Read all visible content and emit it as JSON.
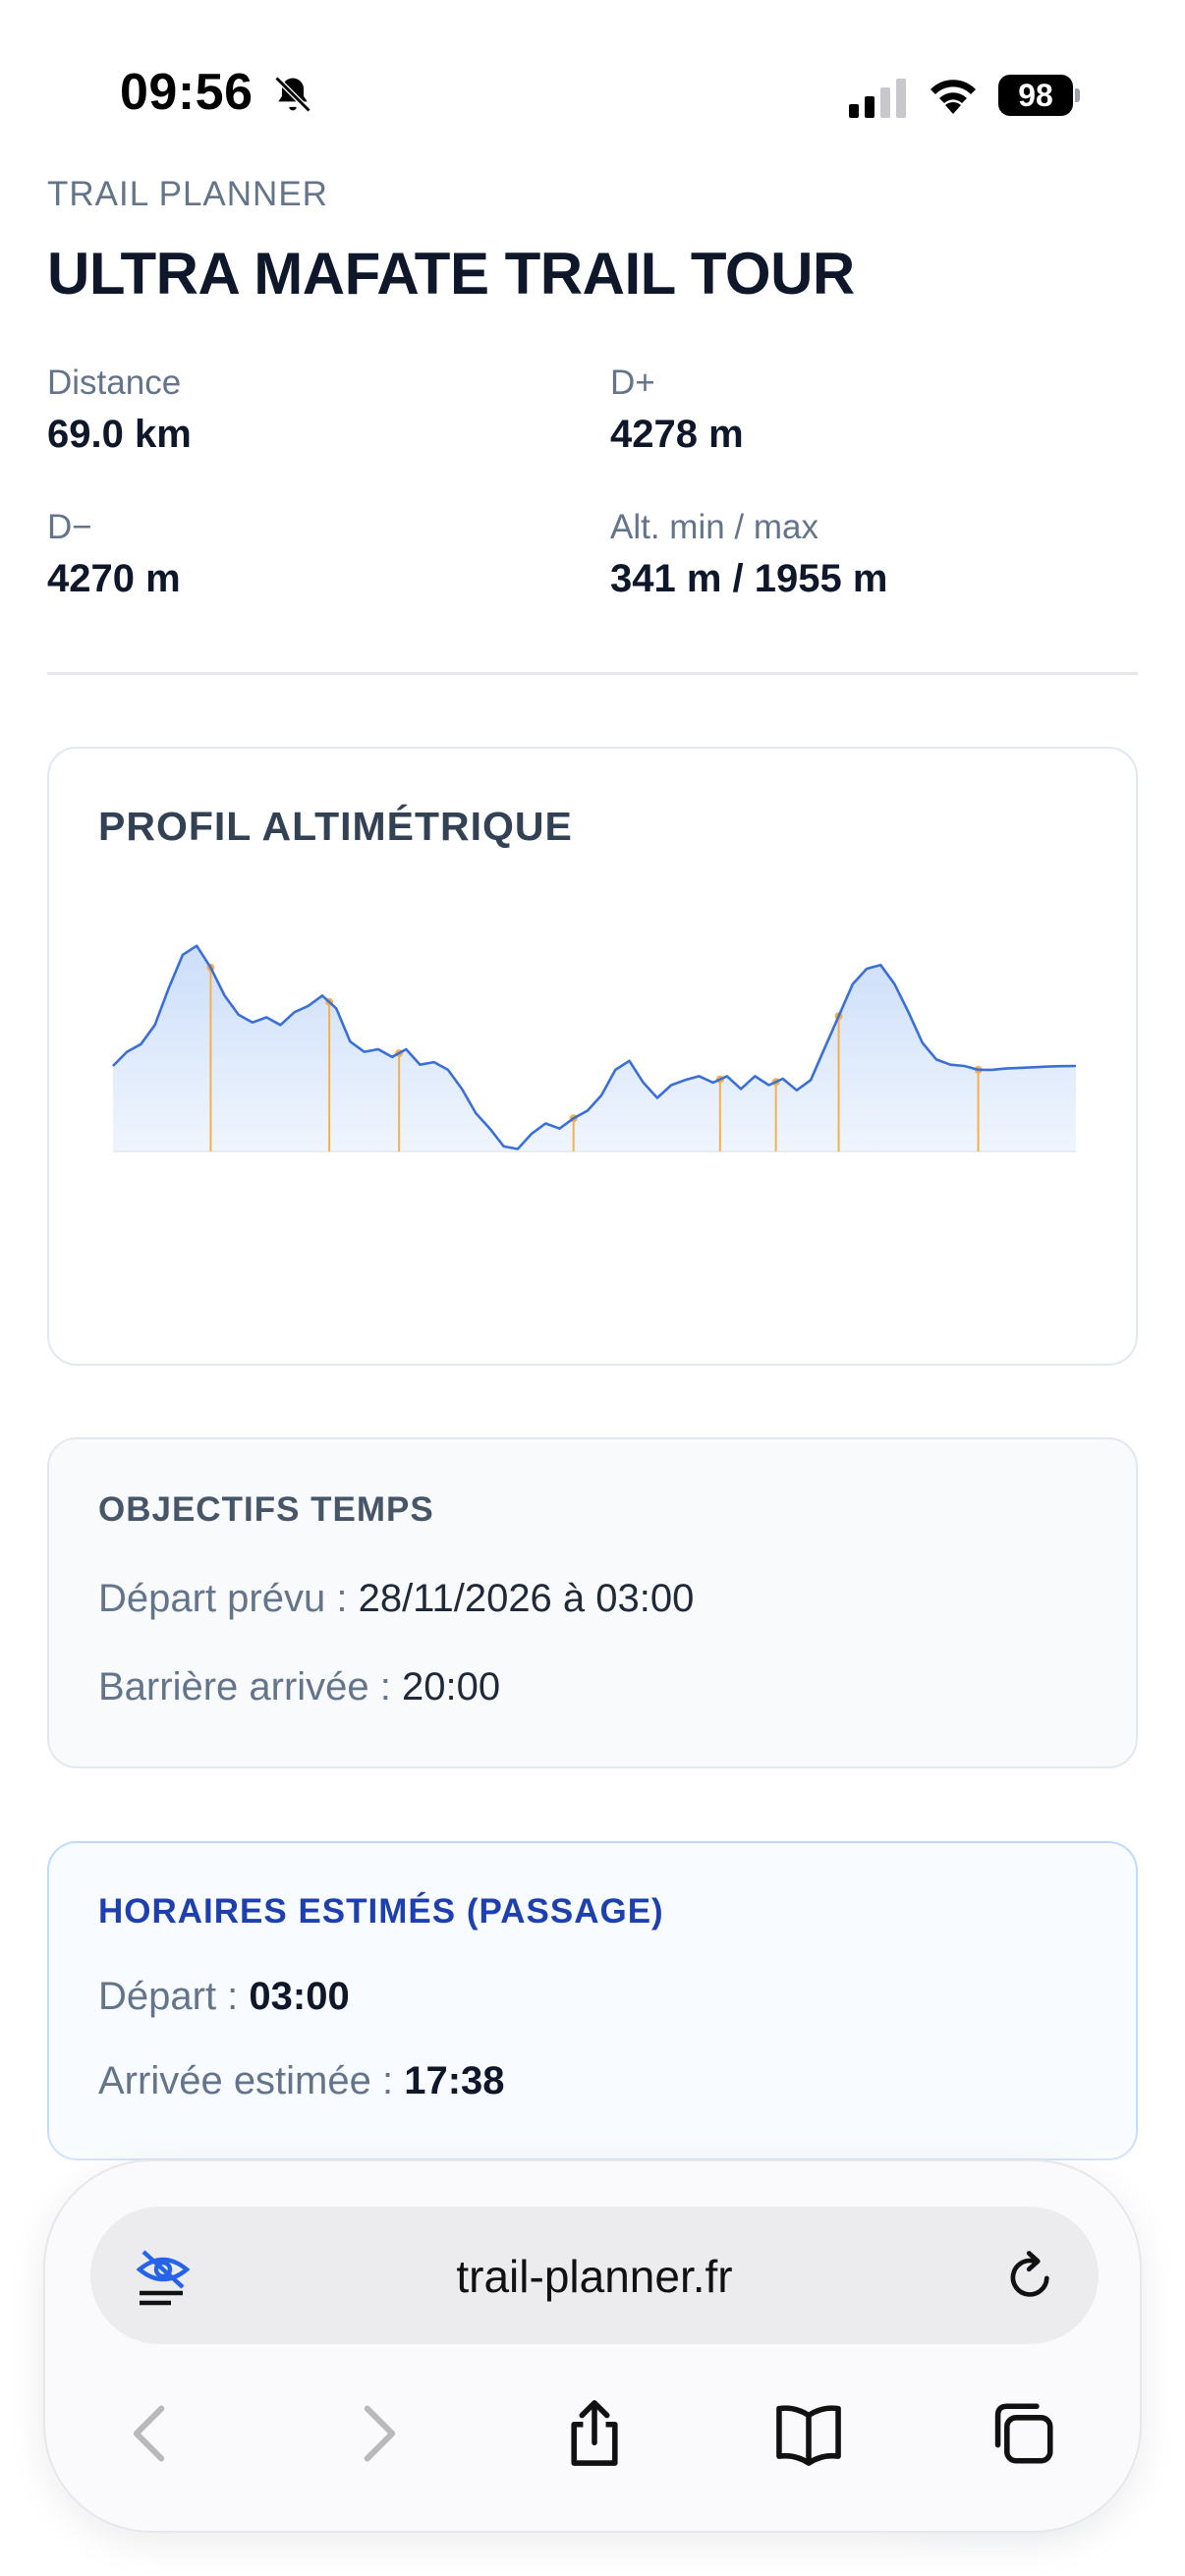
{
  "status_bar": {
    "time": "09:56",
    "battery": "98",
    "icons": [
      "bell-slash-icon",
      "signal-icon",
      "wifi-icon",
      "battery-icon"
    ]
  },
  "header": {
    "eyebrow": "TRAIL PLANNER",
    "title": "ULTRA MAFATE TRAIL TOUR"
  },
  "stats": [
    {
      "label": "Distance",
      "value": "69.0 km"
    },
    {
      "label": "D+",
      "value": "4278 m"
    },
    {
      "label": "D−",
      "value": "4270 m"
    },
    {
      "label": "Alt. min / max",
      "value": "341 m / 1955 m"
    }
  ],
  "profile_card": {
    "title": "PROFIL ALTIMÉTRIQUE"
  },
  "chart_data": {
    "type": "area",
    "xlabel": "",
    "ylabel": "",
    "xlim": [
      0,
      69.0
    ],
    "ylim": [
      341,
      1955
    ],
    "grid": false,
    "legend": "none",
    "line_color": "#3b6fd8",
    "fill_color": "#dbe8fb",
    "marker_color": "#f5b04a",
    "x": [
      0,
      1,
      2,
      3,
      4,
      5,
      6,
      7,
      8,
      9,
      10,
      11,
      12,
      13,
      14,
      15,
      16,
      17,
      18,
      19,
      20,
      21,
      22,
      23,
      24,
      25,
      26,
      27,
      28,
      29,
      30,
      31,
      32,
      33,
      34,
      35,
      36,
      37,
      38,
      39,
      40,
      41,
      42,
      43,
      44,
      45,
      46,
      47,
      48,
      49,
      50,
      51,
      52,
      53,
      54,
      55,
      56,
      57,
      58,
      59,
      60,
      61,
      62,
      63,
      64,
      65,
      66,
      67,
      68,
      69
    ],
    "y": [
      1010,
      1120,
      1180,
      1330,
      1620,
      1880,
      1950,
      1780,
      1560,
      1410,
      1350,
      1390,
      1330,
      1430,
      1480,
      1560,
      1460,
      1200,
      1120,
      1140,
      1080,
      1140,
      1020,
      1040,
      980,
      830,
      640,
      520,
      380,
      360,
      480,
      560,
      520,
      600,
      660,
      780,
      980,
      1050,
      880,
      760,
      860,
      900,
      930,
      880,
      930,
      830,
      930,
      860,
      910,
      820,
      900,
      1150,
      1400,
      1650,
      1770,
      1800,
      1650,
      1430,
      1190,
      1060,
      1020,
      1010,
      980,
      980,
      990,
      995,
      1000,
      1005,
      1008,
      1010
    ],
    "markers_x": [
      7,
      15.5,
      20.5,
      33,
      43.5,
      47.5,
      52,
      62
    ]
  },
  "goals_card": {
    "title": "OBJECTIFS TEMPS",
    "departure_label": "Départ prévu : ",
    "departure_value": "28/11/2026 à 03:00",
    "cutoff_label": "Barrière arrivée : ",
    "cutoff_value": "20:00"
  },
  "times_card": {
    "title": "HORAIRES ESTIMÉS (PASSAGE)",
    "departure_label": "Départ : ",
    "departure_value": "03:00",
    "arrival_label": "Arrivée estimée : ",
    "arrival_value": "17:38"
  },
  "browser": {
    "url": "trail-planner.fr"
  }
}
